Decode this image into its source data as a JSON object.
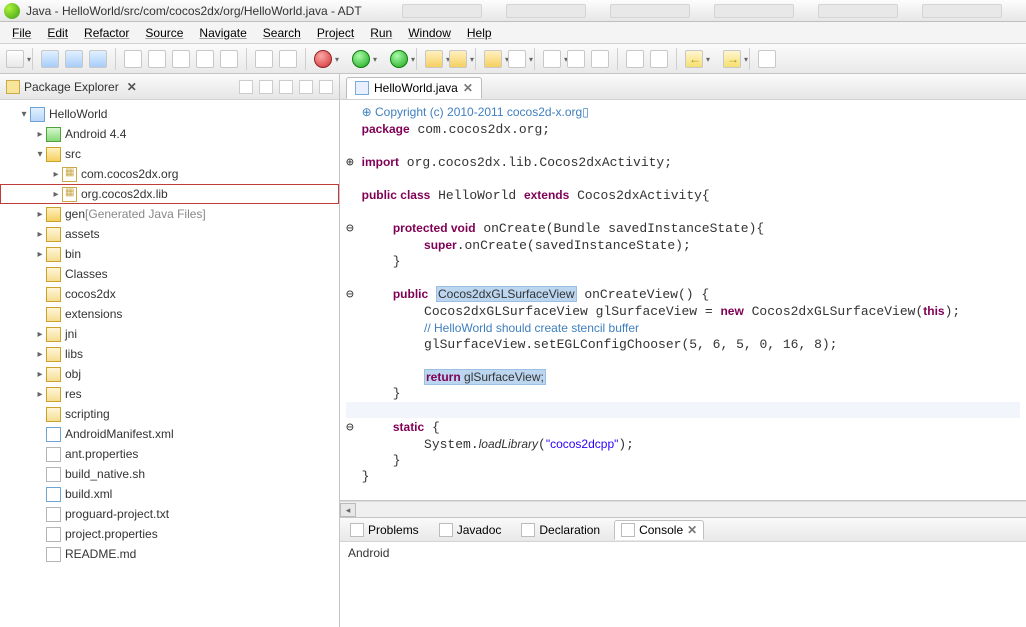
{
  "window_title": "Java - HelloWorld/src/com/cocos2dx/org/HelloWorld.java - ADT",
  "menu": [
    "File",
    "Edit",
    "Refactor",
    "Source",
    "Navigate",
    "Search",
    "Project",
    "Run",
    "Window",
    "Help"
  ],
  "explorer": {
    "title": "Package Explorer",
    "tree": [
      {
        "depth": 1,
        "exp": "▾",
        "icon": "ic-project",
        "label": "HelloWorld"
      },
      {
        "depth": 2,
        "exp": "▸",
        "icon": "ic-android",
        "label": "Android 4.4"
      },
      {
        "depth": 2,
        "exp": "▾",
        "icon": "ic-src",
        "label": "src"
      },
      {
        "depth": 3,
        "exp": "▸",
        "icon": "ic-package",
        "label": "com.cocos2dx.org"
      },
      {
        "depth": 3,
        "exp": "▸",
        "icon": "ic-package",
        "label": "org.cocos2dx.lib",
        "highlight": true
      },
      {
        "depth": 2,
        "exp": "▸",
        "icon": "ic-src",
        "label": "gen ",
        "extra": "[Generated Java Files]"
      },
      {
        "depth": 2,
        "exp": "▸",
        "icon": "ic-folder",
        "label": "assets"
      },
      {
        "depth": 2,
        "exp": "▸",
        "icon": "ic-folder",
        "label": "bin"
      },
      {
        "depth": 2,
        "exp": "",
        "icon": "ic-folder",
        "label": "Classes"
      },
      {
        "depth": 2,
        "exp": "",
        "icon": "ic-folder",
        "label": "cocos2dx"
      },
      {
        "depth": 2,
        "exp": "",
        "icon": "ic-folder",
        "label": "extensions"
      },
      {
        "depth": 2,
        "exp": "▸",
        "icon": "ic-folder",
        "label": "jni"
      },
      {
        "depth": 2,
        "exp": "▸",
        "icon": "ic-folder",
        "label": "libs"
      },
      {
        "depth": 2,
        "exp": "▸",
        "icon": "ic-folder",
        "label": "obj"
      },
      {
        "depth": 2,
        "exp": "▸",
        "icon": "ic-folder",
        "label": "res"
      },
      {
        "depth": 2,
        "exp": "",
        "icon": "ic-folder",
        "label": "scripting"
      },
      {
        "depth": 2,
        "exp": "",
        "icon": "ic-xml",
        "label": "AndroidManifest.xml"
      },
      {
        "depth": 2,
        "exp": "",
        "icon": "ic-file",
        "label": "ant.properties"
      },
      {
        "depth": 2,
        "exp": "",
        "icon": "ic-file",
        "label": "build_native.sh"
      },
      {
        "depth": 2,
        "exp": "",
        "icon": "ic-xml",
        "label": "build.xml"
      },
      {
        "depth": 2,
        "exp": "",
        "icon": "ic-file",
        "label": "proguard-project.txt"
      },
      {
        "depth": 2,
        "exp": "",
        "icon": "ic-file",
        "label": "project.properties"
      },
      {
        "depth": 2,
        "exp": "",
        "icon": "ic-file",
        "label": "README.md"
      }
    ]
  },
  "editor": {
    "tab_title": "HelloWorld.java",
    "code_html": "  <span class='cm'>⊕ Copyright (c) 2010-2011 cocos2d-x.org▯</span>\n  <span class='kw'>package</span> com.cocos2dx.org;\n\n⊕ <span class='kw'>import</span> org.cocos2dx.lib.Cocos2dxActivity;\n\n  <span class='kw'>public class</span> HelloWorld <span class='kw'>extends</span> Cocos2dxActivity{\n\n⊖     <span class='kw'>protected void</span> onCreate(Bundle savedInstanceState){\n          <span class='kw'>super</span>.onCreate(savedInstanceState);\n      }\n\n⊖     <span class='kw'>public</span> <span class='hl'>Cocos2dxGLSurfaceView</span> onCreateView() {\n          Cocos2dxGLSurfaceView glSurfaceView = <span class='kw'>new</span> Cocos2dxGLSurfaceView(<span class='kw'>this</span>);\n          <span class='cm'>// HelloWorld should create stencil buffer</span>\n          glSurfaceView.setEGLConfigChooser(5, 6, 5, 0, 16, 8);\n\n          <span class='hl'><span class='kw'>return</span> glSurfaceView;</span>\n      }\n<span class='cur-line'>      </span>\n⊖     <span class='kw'>static</span> {\n          System.<span class='it'>loadLibrary</span>(<span class='st'>\"cocos2dcpp\"</span>);\n      }\n  }\n"
  },
  "bottom": {
    "tabs": [
      "Problems",
      "Javadoc",
      "Declaration",
      "Console"
    ],
    "active": "Console",
    "console_text": "Android"
  }
}
